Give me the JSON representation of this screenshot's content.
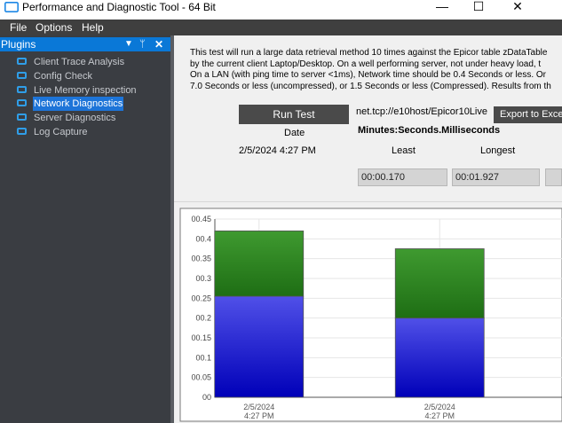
{
  "window": {
    "title": "Performance and Diagnostic Tool - 64 Bit",
    "minimize_glyph": "—",
    "maximize_glyph": "☐",
    "close_glyph": "✕",
    "icon": "app-window-icon"
  },
  "menu": {
    "items": [
      {
        "label": "File"
      },
      {
        "label": "Options"
      },
      {
        "label": "Help"
      }
    ]
  },
  "sidebar": {
    "title": "Plugins",
    "pin_down_glyph": "▼",
    "pin_glyph": "ᛘ",
    "close_glyph": "✕",
    "selected_index": 3,
    "items": [
      {
        "label": "Client Trace Analysis",
        "icon": "window-icon"
      },
      {
        "label": "Config Check",
        "icon": "window-icon"
      },
      {
        "label": "Live Memory inspection",
        "icon": "window-icon"
      },
      {
        "label": "Network Diagnostics",
        "icon": "window-icon"
      },
      {
        "label": "Server Diagnostics",
        "icon": "window-icon"
      },
      {
        "label": "Log Capture",
        "icon": "window-icon"
      }
    ],
    "accent_color": "#0a78d7"
  },
  "network": {
    "description_lines": [
      "This test will run a large data retrieval method 10 times against the Epicor table zDataTable",
      "by the current client Laptop/Desktop. On a well performing server, not under heavy load, t",
      "On a LAN (with ping time to server <1ms), Network time should be 0.4 Seconds or less. Or",
      "7.0 Seconds or less (uncompressed), or 1.5 Seconds or less (Compressed). Results from th"
    ],
    "run_test_label": "Run Test",
    "date_header": "Date",
    "date_value": "2/5/2024 4:27 PM",
    "connection_url": "net.tcp://e10host/Epicor10Live",
    "export_label": "Export to Excel",
    "units_label": "Minutes:Seconds.Milliseconds",
    "col_least": "Least",
    "col_longest": "Longest",
    "least_value": "00:00.170",
    "longest_value": "00:01.927",
    "third_value": ""
  },
  "chart_data": {
    "type": "bar",
    "stacked": true,
    "categories": [
      [
        "2/5/2024",
        "4:27 PM"
      ],
      [
        "2/5/2024",
        "4:27 PM"
      ]
    ],
    "series": [
      {
        "values": [
          0.255,
          0.2
        ],
        "color": "#1a1ad0"
      },
      {
        "values": [
          0.165,
          0.175
        ],
        "color": "#2d8a1e"
      }
    ],
    "yticks": [
      "00.45",
      "00.4",
      "00.35",
      "00.3",
      "00.25",
      "00.2",
      "00.15",
      "00.1",
      "00.05",
      "00"
    ],
    "ylim": [
      0,
      0.45
    ],
    "grid": true
  }
}
